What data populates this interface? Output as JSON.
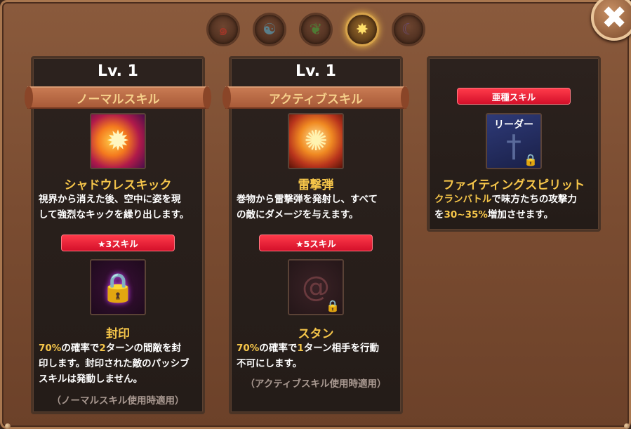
{
  "close_glyph": "✖",
  "element_tabs": [
    {
      "name": "fire",
      "glyph": "๑",
      "active": false
    },
    {
      "name": "water",
      "glyph": "☯",
      "active": false
    },
    {
      "name": "leaf",
      "glyph": "❦",
      "active": false
    },
    {
      "name": "light",
      "glyph": "✸",
      "active": true
    },
    {
      "name": "moon",
      "glyph": "☾",
      "active": false
    }
  ],
  "card1": {
    "level": "Lv. 1",
    "ribbon": "ノーマルスキル",
    "skill_name": "シャドウレスキック",
    "desc_line1": "視界から消えた後、空中に姿を現",
    "desc_line2": "して強烈なキックを繰り出します。",
    "badge": "★3スキル",
    "sub_skill_name": "封印",
    "sub_desc": {
      "p1": "70%",
      "t1": "の確率で",
      "p2": "2",
      "t2": "ターンの間敵を封",
      "line2": "印します。封印された敵のパッシブ",
      "line3": "スキルは発動しません。"
    },
    "note": "（ノーマルスキル使用時適用）"
  },
  "card2": {
    "level": "Lv. 1",
    "ribbon": "アクティブスキル",
    "skill_name": "雷撃弾",
    "desc_line1": "巻物から雷撃弾を発射し、すべて",
    "desc_line2": "の敵にダメージを与えます。",
    "badge": "★5スキル",
    "sub_skill_name": "スタン",
    "sub_desc": {
      "p1": "70%",
      "t1": "の確率で",
      "p2": "1",
      "t2": "ターン相手を行動",
      "line2": "不可にします。"
    },
    "note": "（アクティブスキル使用時適用）"
  },
  "card3": {
    "badge": "亜種スキル",
    "icon_label": "リーダー",
    "skill_name": "ファイティングスピリット",
    "desc": {
      "h1": "クランバトル",
      "t1": "で味方たちの攻撃力",
      "t2": "を",
      "h2": "30~35%",
      "t3": "増加させます。"
    }
  },
  "colors": {
    "accent_gold": "#f6c64a",
    "badge_red": "#e8182e",
    "ribbon": "#b86644",
    "frame": "#7a4c31"
  }
}
